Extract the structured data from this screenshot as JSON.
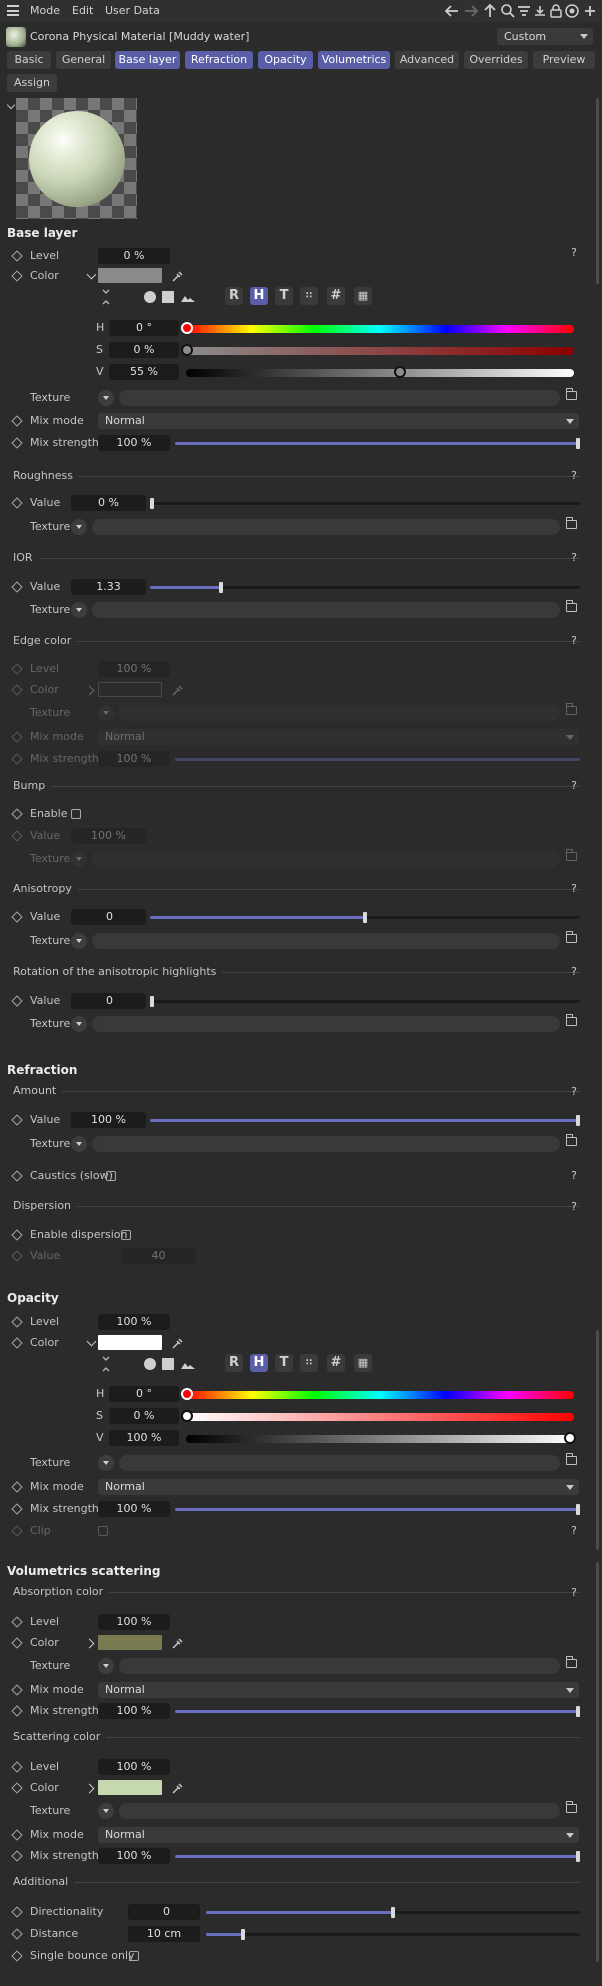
{
  "menu": {
    "mode": "Mode",
    "edit": "Edit",
    "user_data": "User Data"
  },
  "object": {
    "title": "Corona Physical Material [Muddy water]",
    "preset": "Custom"
  },
  "tabs": [
    {
      "label": "Basic",
      "active": false
    },
    {
      "label": "General",
      "active": false
    },
    {
      "label": "Base layer",
      "active": true
    },
    {
      "label": "Refraction",
      "active": true
    },
    {
      "label": "Opacity",
      "active": true
    },
    {
      "label": "Volumetrics",
      "active": true
    },
    {
      "label": "Advanced",
      "active": false
    },
    {
      "label": "Overrides",
      "active": false
    },
    {
      "label": "Preview",
      "active": false
    }
  ],
  "assign": "Assign",
  "labels": {
    "level": "Level",
    "color": "Color",
    "texture": "Texture",
    "mix_mode": "Mix mode",
    "mix_strength": "Mix strength",
    "value": "Value",
    "enable": "Enable",
    "h": "H",
    "s": "S",
    "v": "V",
    "normal": "Normal",
    "help": "?",
    "clip": "Clip"
  },
  "color_buttons": [
    "R",
    "H",
    "T",
    "#"
  ],
  "base_layer": {
    "title": "Base layer",
    "level": "0 %",
    "color_swatch": "#8a8a8a",
    "h": "0 °",
    "s": "0 %",
    "v": "55 %",
    "mix_strength": "100 %",
    "mix_strength_level": 1.0,
    "roughness": {
      "title": "Roughness",
      "value": "0 %",
      "level": 0.0
    },
    "ior": {
      "title": "IOR",
      "value": "1.33",
      "level": 0.15
    },
    "edge_color": {
      "title": "Edge color",
      "level": "100 %",
      "mix_strength": "100 %"
    },
    "bump": {
      "title": "Bump",
      "enable": false,
      "value": "100 %"
    },
    "anisotropy": {
      "title": "Anisotropy",
      "value": "0",
      "level": 0.5
    },
    "rotation": {
      "title": "Rotation of the anisotropic highlights",
      "value": "0",
      "level": 0.0
    }
  },
  "refraction": {
    "title": "Refraction",
    "amount": {
      "title": "Amount",
      "value": "100 %",
      "level": 1.0
    },
    "caustics": {
      "label": "Caustics (slow)",
      "checked": false
    },
    "dispersion": {
      "title": "Dispersion",
      "enable_label": "Enable dispersion",
      "checked": false,
      "value": "40"
    }
  },
  "opacity": {
    "title": "Opacity",
    "level": "100 %",
    "color_swatch": "#ffffff",
    "h": "0 °",
    "s": "0 %",
    "v": "100 %",
    "mix_strength": "100 %"
  },
  "volumetrics": {
    "title": "Volumetrics scattering",
    "absorption": {
      "title": "Absorption color",
      "level": "100 %",
      "color_swatch": "#7a7a50",
      "mix_strength": "100 %"
    },
    "scattering": {
      "title": "Scattering color",
      "level": "100 %",
      "color_swatch": "#c6d8ae",
      "mix_strength": "100 %"
    },
    "additional": {
      "title": "Additional",
      "directionality_label": "Directionality",
      "directionality": "0",
      "directionality_level": 0.5,
      "distance_label": "Distance",
      "distance": "10 cm",
      "distance_level": 0.1,
      "single_bounce_label": "Single bounce only",
      "single_bounce": false
    }
  },
  "colors": {
    "accent": "#5a5ea6",
    "slider_fill": "#6b6fc0"
  }
}
